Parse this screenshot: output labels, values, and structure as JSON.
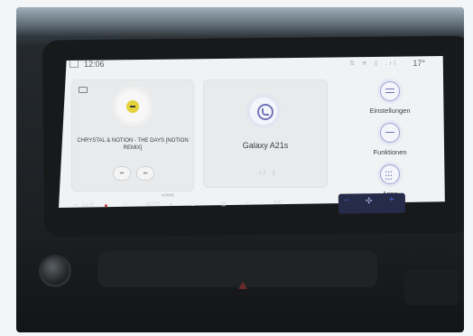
{
  "status": {
    "time": "12:06",
    "outside_temp": "17°",
    "icons": "⇅ ≋ ▯ .ıl"
  },
  "media": {
    "track": "CHRYSTAL & NOTION - THE DAYS [NOTION REMIX]",
    "prev_label": "⏮",
    "next_label": "⏭"
  },
  "phone": {
    "device": "Galaxy A21s",
    "status_icons": ".ıl ▯"
  },
  "side_menu": {
    "settings": "Einstellungen",
    "functions": "Funktionen",
    "apps": "Apps"
  },
  "climate": {
    "temp_left": "21.5°",
    "auto_label": "AUTO",
    "ac_label": "A/C",
    "vorne_label": "VORNE"
  }
}
